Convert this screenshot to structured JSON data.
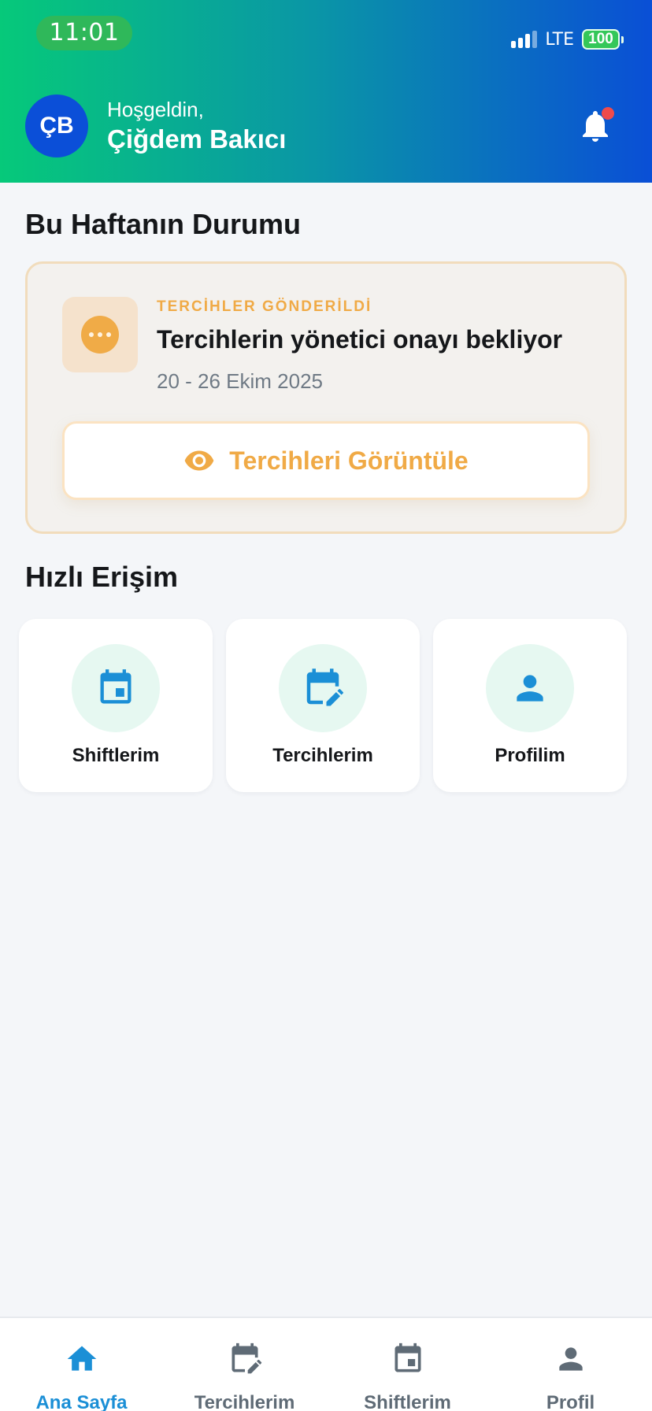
{
  "status_bar": {
    "time": "11:01",
    "network": "LTE",
    "battery": "100"
  },
  "header": {
    "avatar_initials": "ÇB",
    "greeting": "Hoşgeldin,",
    "user_name": "Çiğdem Bakıcı",
    "notification_icon": "bell-icon",
    "has_unread": true
  },
  "weekly_status": {
    "section_title": "Bu Haftanın Durumu",
    "eyebrow": "TERCİHLER GÖNDERİLDİ",
    "heading": "Tercihlerin yönetici onayı bekliyor",
    "date_range": "20 - 26 Ekim 2025",
    "status_icon": "more-horizontal-icon",
    "button_label": "Tercihleri Görüntüle",
    "button_icon": "eye-icon"
  },
  "quick_access": {
    "section_title": "Hızlı Erişim",
    "items": [
      {
        "label": "Shiftlerim",
        "icon": "calendar-icon"
      },
      {
        "label": "Tercihlerim",
        "icon": "calendar-edit-icon"
      },
      {
        "label": "Profilim",
        "icon": "person-icon"
      }
    ]
  },
  "tab_bar": {
    "active_index": 0,
    "items": [
      {
        "label": "Ana Sayfa",
        "icon": "home-icon"
      },
      {
        "label": "Tercihlerim",
        "icon": "calendar-edit-icon"
      },
      {
        "label": "Shiftlerim",
        "icon": "calendar-icon"
      },
      {
        "label": "Profil",
        "icon": "person-icon"
      }
    ]
  },
  "colors": {
    "accent_orange": "#f0aa46",
    "accent_blue": "#1b8fd6",
    "header_gradient_start": "#06c97a",
    "header_gradient_end": "#0a4fd6",
    "notification_dot": "#ef4b4b",
    "quick_icon_bg": "#e6f8f1"
  }
}
